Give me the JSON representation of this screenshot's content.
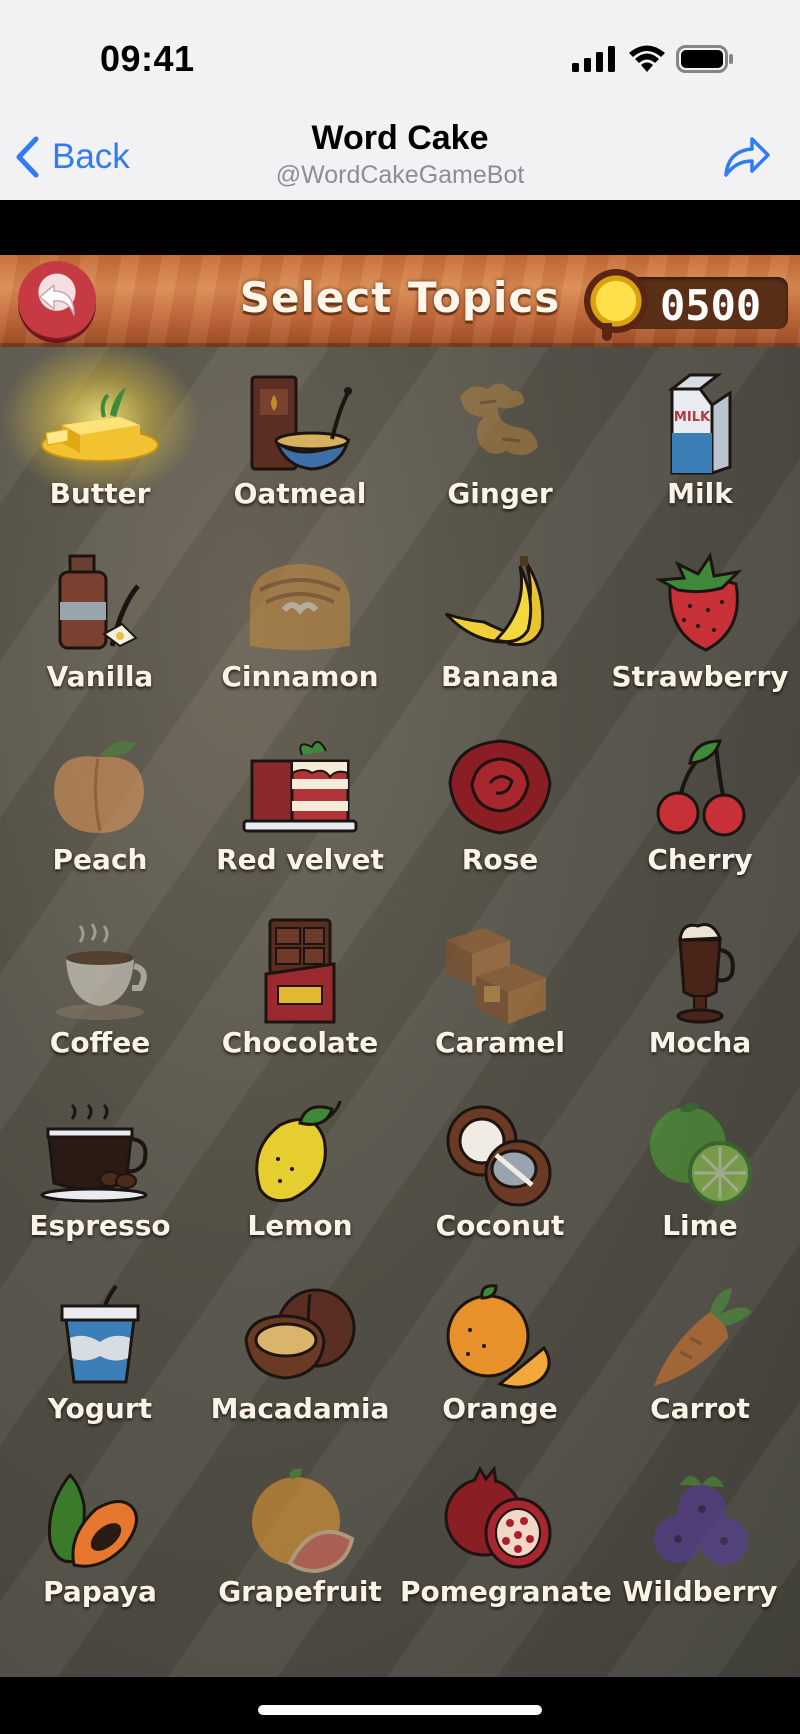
{
  "status": {
    "time": "09:41"
  },
  "nav": {
    "back_label": "Back",
    "title": "Word Cake",
    "subtitle": "@WordCakeGameBot"
  },
  "game": {
    "title": "Select Topics",
    "coins": "0500"
  },
  "topics": [
    {
      "label": "Butter",
      "icon": "butter-icon",
      "selected": true
    },
    {
      "label": "Oatmeal",
      "icon": "oatmeal-icon"
    },
    {
      "label": "Ginger",
      "icon": "ginger-icon"
    },
    {
      "label": "Milk",
      "icon": "milk-icon",
      "icon_text": "MILK"
    },
    {
      "label": "Vanilla",
      "icon": "vanilla-icon"
    },
    {
      "label": "Cinnamon",
      "icon": "cinnamon-roll-icon"
    },
    {
      "label": "Banana",
      "icon": "banana-icon"
    },
    {
      "label": "Strawberry",
      "icon": "strawberry-icon"
    },
    {
      "label": "Peach",
      "icon": "peach-icon"
    },
    {
      "label": "Red velvet",
      "icon": "red-velvet-cake-icon"
    },
    {
      "label": "Rose",
      "icon": "rose-icon"
    },
    {
      "label": "Cherry",
      "icon": "cherry-icon"
    },
    {
      "label": "Coffee",
      "icon": "coffee-cup-icon"
    },
    {
      "label": "Chocolate",
      "icon": "chocolate-bar-icon"
    },
    {
      "label": "Caramel",
      "icon": "caramel-icon"
    },
    {
      "label": "Mocha",
      "icon": "mocha-icon"
    },
    {
      "label": "Espresso",
      "icon": "espresso-icon"
    },
    {
      "label": "Lemon",
      "icon": "lemon-icon"
    },
    {
      "label": "Coconut",
      "icon": "coconut-icon"
    },
    {
      "label": "Lime",
      "icon": "lime-icon"
    },
    {
      "label": "Yogurt",
      "icon": "yogurt-icon"
    },
    {
      "label": "Macadamia",
      "icon": "macadamia-icon"
    },
    {
      "label": "Orange",
      "icon": "orange-icon"
    },
    {
      "label": "Carrot",
      "icon": "carrot-icon"
    },
    {
      "label": "Papaya",
      "icon": "papaya-icon"
    },
    {
      "label": "Grapefruit",
      "icon": "grapefruit-icon"
    },
    {
      "label": "Pomegranate",
      "icon": "pomegranate-icon"
    },
    {
      "label": "Wildberry",
      "icon": "wildberry-icon"
    }
  ],
  "colors": {
    "ios_blue": "#2f7cf6",
    "header_wood": "#c46a36",
    "board_bg": "#55524a",
    "coin_gold": "#ffe04a",
    "selected_glow": "#ffe37a"
  }
}
